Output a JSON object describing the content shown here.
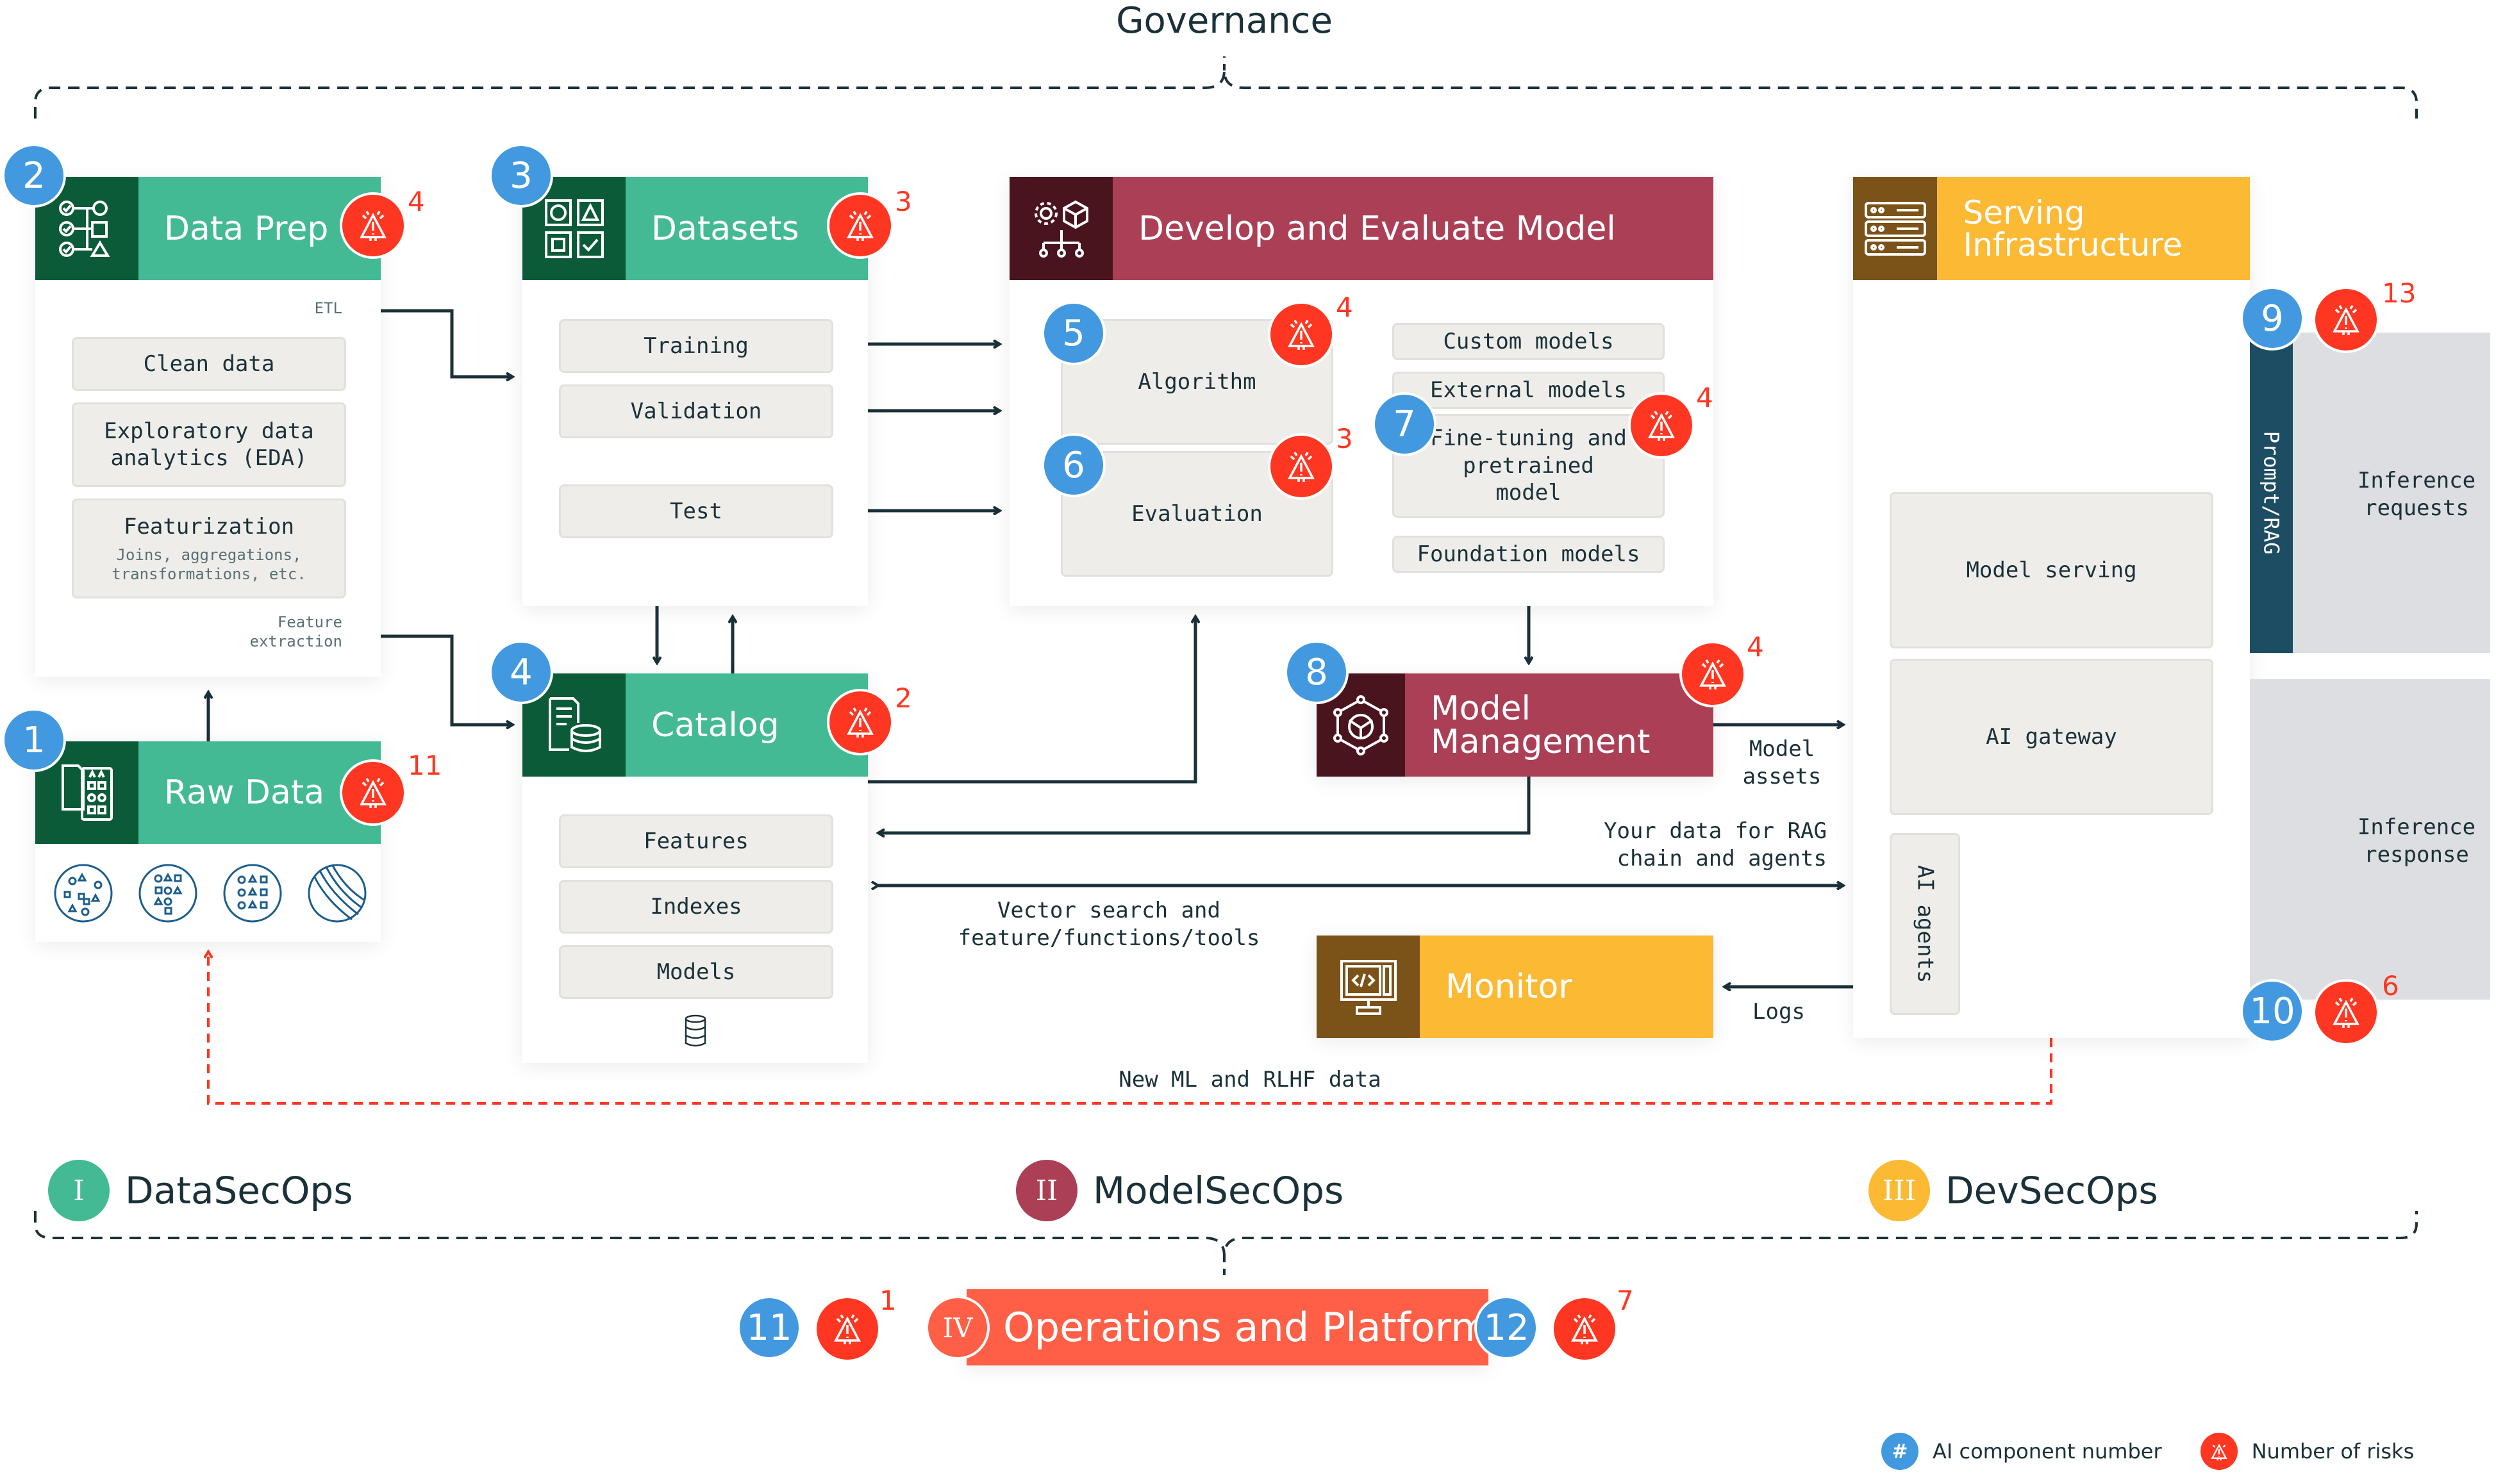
{
  "title": "Governance",
  "colors": {
    "data_green": "#43ba93",
    "data_green_dark": "#0c5b38",
    "model_red": "#ab3f56",
    "model_red_dark": "#4a141f",
    "dev_yellow": "#fbb934",
    "dev_brown": "#7b5218",
    "ops_orange": "#ff5f46",
    "number_blue": "#4299e0",
    "risk_red": "#ff3621",
    "rag_teal": "#1d4d63"
  },
  "components": {
    "data_prep": {
      "number": "2",
      "title": "Data Prep",
      "risks": "4",
      "etl_label": "ETL",
      "items": [
        {
          "label": "Clean data"
        },
        {
          "label": "Exploratory data analytics (EDA)"
        },
        {
          "label": "Featurization",
          "sub": "Joins, aggregations, transformations, etc."
        }
      ],
      "feature_extraction_label": "Feature extraction"
    },
    "datasets": {
      "number": "3",
      "title": "Datasets",
      "risks": "3",
      "items": [
        {
          "label": "Training"
        },
        {
          "label": "Validation"
        },
        {
          "label": "Test"
        }
      ]
    },
    "develop": {
      "title": "Develop and Evaluate Model",
      "algorithm": {
        "number": "5",
        "label": "Algorithm",
        "risks": "4"
      },
      "evaluation": {
        "number": "6",
        "label": "Evaluation",
        "risks": "3"
      },
      "models": [
        {
          "label": "Custom models"
        },
        {
          "label": "External models"
        },
        {
          "label": "Fine-tuning and pretrained model"
        },
        {
          "label": "Foundation models"
        }
      ],
      "finetune": {
        "number": "7",
        "risks": "4"
      }
    },
    "serving": {
      "title": "Serving Infrastructure",
      "items": [
        {
          "label": "Model serving"
        },
        {
          "label": "AI gateway"
        },
        {
          "label": "AI agents"
        }
      ],
      "prompt": {
        "number": "9",
        "risks": "13",
        "strip_label": "Prompt/RAG",
        "label": "Inference requests"
      },
      "response": {
        "number": "10",
        "risks": "6",
        "label": "Inference response"
      }
    },
    "raw_data": {
      "number": "1",
      "title": "Raw Data",
      "risks": "11"
    },
    "catalog": {
      "number": "4",
      "title": "Catalog",
      "risks": "2",
      "items": [
        {
          "label": "Features"
        },
        {
          "label": "Indexes"
        },
        {
          "label": "Models"
        }
      ]
    },
    "model_mgmt": {
      "number": "8",
      "title": "Model Management",
      "risks": "4"
    },
    "monitor": {
      "title": "Monitor"
    }
  },
  "flow_labels": {
    "model_assets": "Model assets",
    "rag_data": "Your data for RAG chain and agents",
    "vector_search": "Vector search and feature/functions/tools",
    "logs": "Logs",
    "feedback": "New ML and RLHF data"
  },
  "secops": [
    {
      "numeral": "I",
      "label": "DataSecOps"
    },
    {
      "numeral": "II",
      "label": "ModelSecOps"
    },
    {
      "numeral": "III",
      "label": "DevSecOps"
    }
  ],
  "operations": {
    "numeral": "IV",
    "label": "Operations and Platform",
    "left": {
      "number": "11",
      "risks": "1"
    },
    "right": {
      "number": "12",
      "risks": "7"
    }
  },
  "legend": [
    {
      "symbol": "#",
      "label": "AI component number"
    },
    {
      "label": "Number of risks"
    }
  ]
}
